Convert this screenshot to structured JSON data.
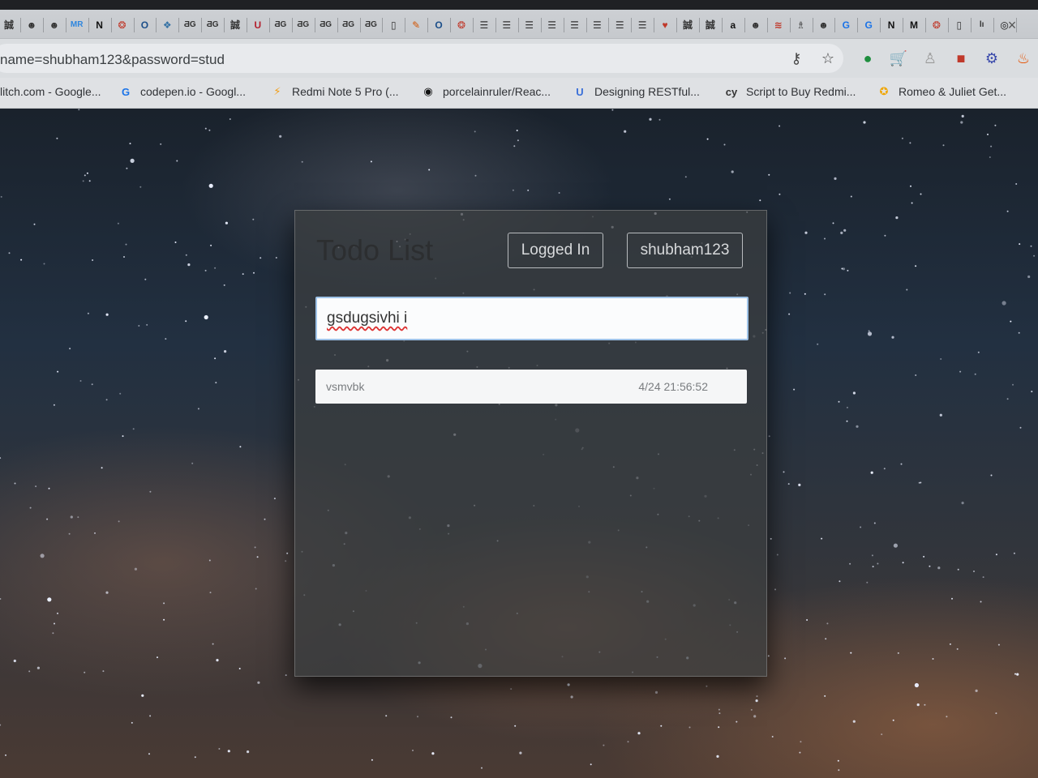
{
  "browser": {
    "tabs": [
      {
        "icon": "chinese-char-icon",
        "glyph": "誠"
      },
      {
        "icon": "avatar-icon",
        "glyph": "☻"
      },
      {
        "icon": "avatar-icon",
        "glyph": "☻"
      },
      {
        "icon": "mr-icon",
        "glyph": "MR"
      },
      {
        "icon": "notion-icon",
        "glyph": "N"
      },
      {
        "icon": "opera-icon",
        "glyph": "❂"
      },
      {
        "icon": "o-icon",
        "glyph": "O"
      },
      {
        "icon": "python-icon",
        "glyph": "❖"
      },
      {
        "icon": "dg-icon",
        "glyph": "ƋG"
      },
      {
        "icon": "dg-icon",
        "glyph": "ƋG"
      },
      {
        "icon": "chinese-char-icon",
        "glyph": "誠"
      },
      {
        "icon": "udemy-icon",
        "glyph": "U"
      },
      {
        "icon": "dg-icon",
        "glyph": "ƋG"
      },
      {
        "icon": "dg-icon",
        "glyph": "ƋG"
      },
      {
        "icon": "dg-icon",
        "glyph": "ƋG"
      },
      {
        "icon": "dg-icon",
        "glyph": "ƋG"
      },
      {
        "icon": "dg-icon",
        "glyph": "ƋG"
      },
      {
        "icon": "document-icon",
        "glyph": "▯"
      },
      {
        "icon": "edit-icon",
        "glyph": "✎"
      },
      {
        "icon": "o-icon",
        "glyph": "O"
      },
      {
        "icon": "opera-icon",
        "glyph": "❂"
      },
      {
        "icon": "list-icon",
        "glyph": "☰"
      },
      {
        "icon": "list-icon",
        "glyph": "☰"
      },
      {
        "icon": "list-icon",
        "glyph": "☰"
      },
      {
        "icon": "list-icon",
        "glyph": "☰"
      },
      {
        "icon": "list-icon",
        "glyph": "☰"
      },
      {
        "icon": "list-icon",
        "glyph": "☰"
      },
      {
        "icon": "list-icon",
        "glyph": "☰"
      },
      {
        "icon": "list-icon",
        "glyph": "☰"
      },
      {
        "icon": "heart-icon",
        "glyph": "♥"
      },
      {
        "icon": "chinese-char-icon",
        "glyph": "誠"
      },
      {
        "icon": "chinese-char-icon",
        "glyph": "誠"
      },
      {
        "icon": "amazon-icon",
        "glyph": "a"
      },
      {
        "icon": "avatar-icon",
        "glyph": "☻"
      },
      {
        "icon": "flag-icon",
        "glyph": "≋"
      },
      {
        "icon": "ghost-icon",
        "glyph": "♗"
      },
      {
        "icon": "avatar-icon",
        "glyph": "☻"
      },
      {
        "icon": "google-icon",
        "glyph": "G"
      },
      {
        "icon": "google-icon",
        "glyph": "G"
      },
      {
        "icon": "notion-icon",
        "glyph": "N"
      },
      {
        "icon": "medium-icon",
        "glyph": "M"
      },
      {
        "icon": "opera-icon",
        "glyph": "❂"
      },
      {
        "icon": "document-icon",
        "glyph": "▯"
      },
      {
        "icon": "library-icon",
        "glyph": "lı"
      },
      {
        "icon": "github-icon",
        "glyph": "◎"
      }
    ],
    "tab_close": "×",
    "url": "name=shubham123&password=stud",
    "toolbar_icons": [
      {
        "name": "key-icon",
        "glyph": "⚷"
      },
      {
        "name": "star-icon",
        "glyph": "☆"
      },
      {
        "name": "extension-green-icon",
        "glyph": "●"
      },
      {
        "name": "cart-icon",
        "glyph": "🛒"
      },
      {
        "name": "extension-grey-icon",
        "glyph": "♙"
      },
      {
        "name": "extension-red-icon",
        "glyph": "■"
      },
      {
        "name": "extension-blue-icon",
        "glyph": "⚙"
      },
      {
        "name": "extension-flame-icon",
        "glyph": "♨"
      }
    ],
    "bookmarks": [
      {
        "icon": "generic-icon",
        "glyph": "",
        "label": "litch.com - Google..."
      },
      {
        "icon": "google-icon",
        "glyph": "G",
        "label": "codepen.io - Googl..."
      },
      {
        "icon": "redmi-icon",
        "glyph": "⚡",
        "label": "Redmi Note 5 Pro (..."
      },
      {
        "icon": "github-icon",
        "glyph": "◉",
        "label": "porcelainruler/Reac..."
      },
      {
        "icon": "udemy-icon",
        "glyph": "U",
        "label": "Designing RESTful..."
      },
      {
        "icon": "cy-icon",
        "glyph": "cy",
        "label": "Script to Buy Redmi..."
      },
      {
        "icon": "star-badge-icon",
        "glyph": "✪",
        "label": "Romeo & Juliet Get..."
      }
    ]
  },
  "app": {
    "title": "Todo List",
    "status_button": "Logged In",
    "user_button": "shubham123",
    "input_value": "gsdugsivhi i",
    "todos": [
      {
        "text": "vsmvbk",
        "time": "4/24 21:56:52"
      }
    ]
  }
}
